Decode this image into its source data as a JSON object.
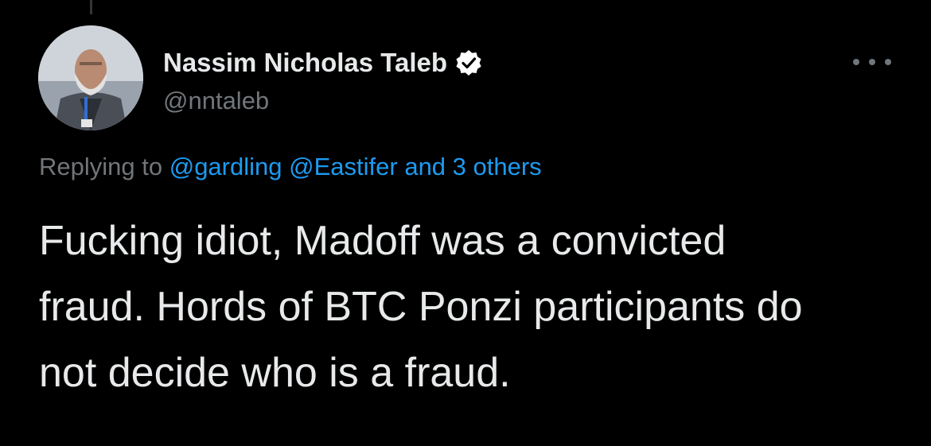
{
  "author": {
    "display_name": "Nassim Nicholas Taleb",
    "handle": "@nntaleb",
    "verified": true,
    "avatar_icon": "profile-photo"
  },
  "reply_context": {
    "prefix": "Replying to",
    "mention_1": "@gardling",
    "mention_2": "@Eastifer",
    "others": "and 3 others"
  },
  "tweet": {
    "lines": [
      "Fucking idiot, Madoff was a convicted",
      "fraud. Hords of BTC Ponzi participants do",
      "not decide who is a fraud."
    ]
  },
  "colors": {
    "background": "#000000",
    "text_primary": "#e7e9ea",
    "text_secondary": "#71767b",
    "accent": "#1d9bf0"
  },
  "icons": {
    "more": "more-options-icon",
    "verified": "verified-badge-icon"
  }
}
